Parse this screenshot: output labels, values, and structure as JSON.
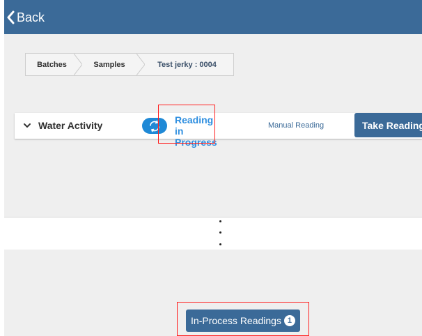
{
  "header": {
    "back_label": "Back"
  },
  "breadcrumb": {
    "items": [
      {
        "label": "Batches"
      },
      {
        "label": "Samples"
      },
      {
        "label": "Test jerky : 0004"
      }
    ]
  },
  "water_activity": {
    "title": "Water Activity",
    "status_text": "Reading in Progress",
    "manual_label": "Manual Reading",
    "take_reading_label": "Take Reading"
  },
  "footer": {
    "in_process_label": "In-Process Readings",
    "badge_count": "1"
  },
  "icons": {
    "back": "chevron-left-icon",
    "expand": "chevron-down-icon",
    "status": "sync-icon"
  },
  "colors": {
    "header_bg": "#3b6a98",
    "accent": "#1f89d6",
    "highlight": "#ff1f1f",
    "page_bg": "#efefef"
  }
}
